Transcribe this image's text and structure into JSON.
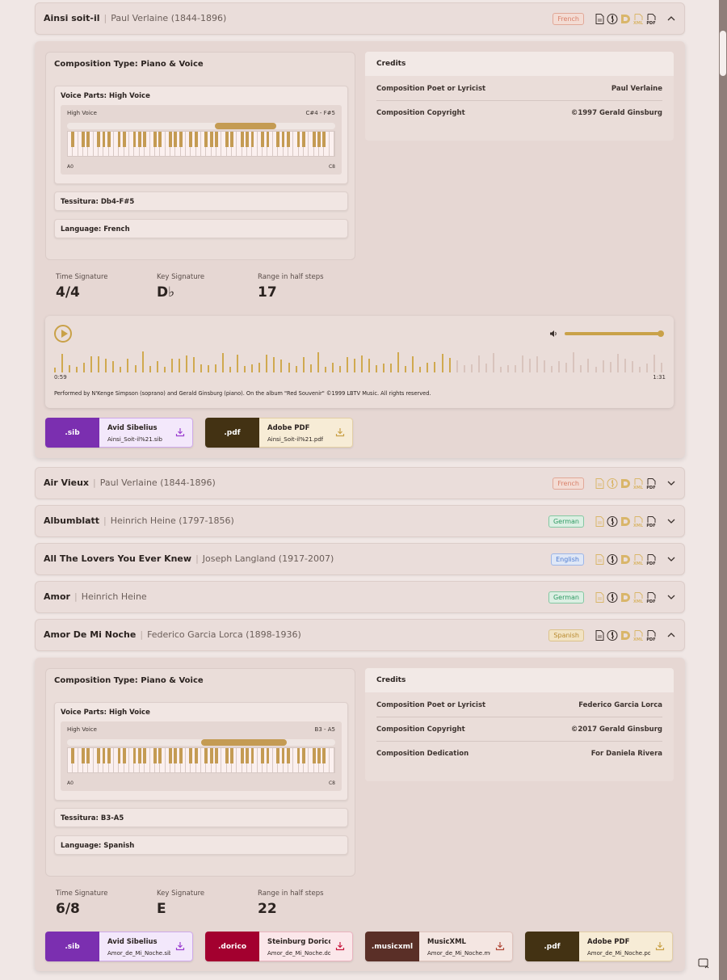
{
  "songs": [
    {
      "title": "Ainsi soit-il",
      "author": "Paul Verlaine (1844-1896)",
      "language_badge": "French",
      "expanded": true
    },
    {
      "title": "Air Vieux",
      "author": "Paul Verlaine (1844-1896)",
      "language_badge": "French",
      "expanded": false
    },
    {
      "title": "Albumblatt",
      "author": "Heinrich Heine (1797-1856)",
      "language_badge": "German",
      "expanded": false
    },
    {
      "title": "All The Lovers You Ever Knew",
      "author": "Joseph Langland (1917-2007)",
      "language_badge": "English",
      "expanded": false
    },
    {
      "title": "Amor",
      "author": "Heinrich Heine",
      "language_badge": "German",
      "expanded": false
    },
    {
      "title": "Amor De Mi Noche",
      "author": "Federico Garcia Lorca (1898-1936)",
      "language_badge": "Spanish",
      "expanded": true
    }
  ],
  "format_icons": [
    "document-icon",
    "treble-clef-icon",
    "dorico-icon",
    "xml-icon",
    "pdf-icon"
  ],
  "xml_label": "XML",
  "pdf_label": "PDF",
  "detail1": {
    "composition_type": "Composition Type: Piano & Voice",
    "voice_parts": "Voice Parts: High Voice",
    "keyboard": {
      "voice": "High Voice",
      "range": "C#4 - F#5",
      "low": "A0",
      "high": "C8",
      "range_fraction": [
        0.55,
        0.78
      ]
    },
    "tessitura": "Tessitura: Db4-F#5",
    "language": "Language: French",
    "credits_title": "Credits",
    "credits": [
      {
        "label": "Composition Poet or Lyricist",
        "value": "Paul Verlaine"
      },
      {
        "label": "Composition Copyright",
        "value": "©1997 Gerald Ginsburg"
      }
    ],
    "stats": [
      {
        "label": "Time Signature",
        "value": "4/4"
      },
      {
        "label": "Key Signature",
        "value": "D♭"
      },
      {
        "label": "Range in half steps",
        "value": "17"
      }
    ],
    "player": {
      "current_time": "0:59",
      "duration": "1:31",
      "played_fraction": 0.648,
      "volume_fraction": 1.0,
      "performance": "Performed by N'Kenge Simpson (soprano) and Gerald Ginsburg (piano). On the album \"Red Souvenir\" ©1999 LBTV Music. All rights reserved."
    },
    "downloads": [
      {
        "ext": ".sib",
        "name": "Avid Sibelius",
        "file": "Ainsi_Soit-il%21.sib",
        "color": "#7b2fb0",
        "bg": "#f3e8fb",
        "border": "#cfa9ea",
        "icon_color": "#9b3fd0"
      },
      {
        "ext": ".pdf",
        "name": "Adobe PDF",
        "file": "Ainsi_Soit-il%21.pdf",
        "color": "#433213",
        "bg": "#f7ecd6",
        "border": "#e3cfa5",
        "icon_color": "#c9a148"
      }
    ]
  },
  "detail2": {
    "composition_type": "Composition Type: Piano & Voice",
    "voice_parts": "Voice Parts: High Voice",
    "keyboard": {
      "voice": "High Voice",
      "range": "B3 - A5",
      "low": "A0",
      "high": "C8",
      "range_fraction": [
        0.5,
        0.82
      ]
    },
    "tessitura": "Tessitura: B3-A5",
    "language": "Language: Spanish",
    "credits_title": "Credits",
    "credits": [
      {
        "label": "Composition Poet or Lyricist",
        "value": "Federico Garcia Lorca"
      },
      {
        "label": "Composition Copyright",
        "value": "©2017 Gerald Ginsburg"
      },
      {
        "label": "Composition Dedication",
        "value": "For Daniela Rivera"
      }
    ],
    "stats": [
      {
        "label": "Time Signature",
        "value": "6/8"
      },
      {
        "label": "Key Signature",
        "value": "E"
      },
      {
        "label": "Range in half steps",
        "value": "22"
      }
    ],
    "downloads": [
      {
        "ext": ".sib",
        "name": "Avid Sibelius",
        "file": "Amor_de_Mi_Noche.sib",
        "color": "#7b2fb0",
        "bg": "#f3e8fb",
        "border": "#cfa9ea",
        "icon_color": "#9b3fd0"
      },
      {
        "ext": ".dorico",
        "name": "Steinburg Dorico",
        "file": "Amor_de_Mi_Noche.dorico",
        "color": "#a3002f",
        "bg": "#fbe7ea",
        "border": "#eab3bf",
        "icon_color": "#c8193f"
      },
      {
        "ext": ".musicxml",
        "name": "MusicXML",
        "file": "Amor_de_Mi_Noche.musicxml",
        "color": "#5a2f27",
        "bg": "#f4e6e2",
        "border": "#dfc3bc",
        "icon_color": "#b04a3a"
      },
      {
        "ext": ".pdf",
        "name": "Adobe PDF",
        "file": "Amor_de_Mi_Noche.pdf",
        "color": "#433213",
        "bg": "#f7ecd6",
        "border": "#e3cfa5",
        "icon_color": "#c9a148"
      }
    ]
  }
}
